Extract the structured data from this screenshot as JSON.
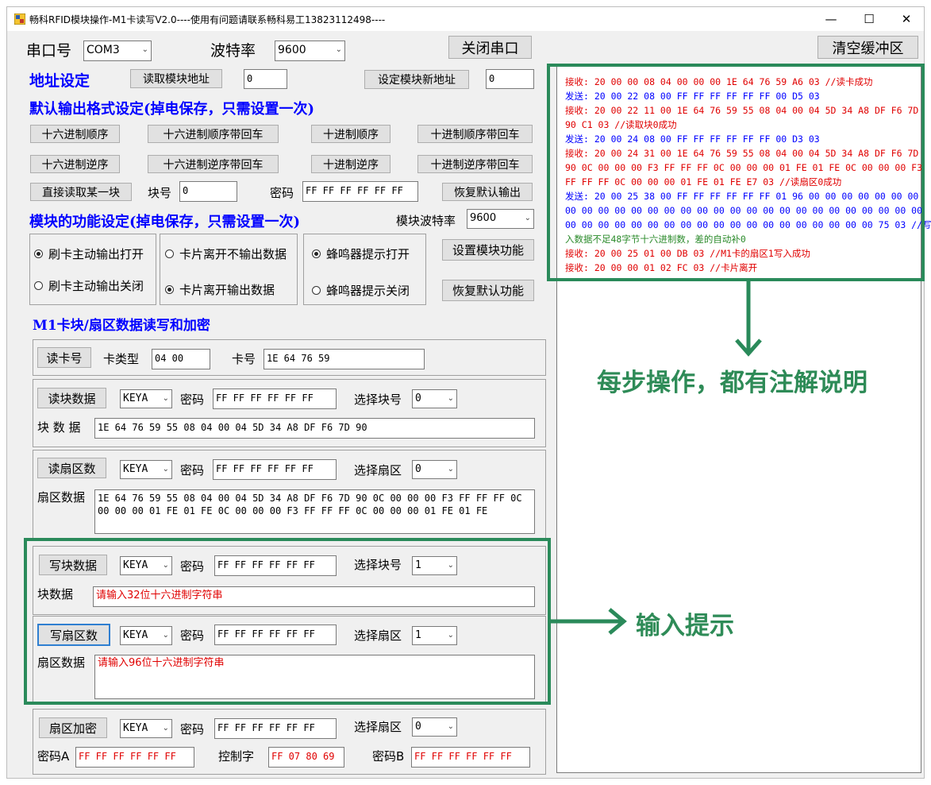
{
  "window": {
    "title": "畅科RFID模块操作-M1卡读写V2.0----使用有问题请联系畅科易工13823112498----",
    "minimize": "—",
    "maximize": "☐",
    "close": "✕"
  },
  "serial": {
    "port_label": "串口号",
    "port_value": "COM3",
    "baud_label": "波特率",
    "baud_value": "9600",
    "close_port_button": "关闭串口",
    "clear_buffer_button": "清空缓冲区"
  },
  "address": {
    "heading": "地址设定",
    "read_button": "读取模块地址",
    "read_value": "0",
    "set_button": "设定模块新地址",
    "set_value": "0"
  },
  "output_format": {
    "heading": "默认输出格式设定(掉电保存，只需设置一次)",
    "buttons": [
      "十六进制顺序",
      "十六进制顺序带回车",
      "十进制顺序",
      "十进制顺序带回车",
      "十六进制逆序",
      "十六进制逆序带回车",
      "十进制逆序",
      "十进制逆序带回车"
    ],
    "direct_read_button": "直接读取某一块",
    "block_label": "块号",
    "block_value": "0",
    "password_label": "密码",
    "password_value": "FF FF FF FF FF FF",
    "restore_output_button": "恢复默认输出"
  },
  "module_function": {
    "heading": "模块的功能设定(掉电保存，只需设置一次)",
    "baud_label": "模块波特率",
    "baud_value": "9600",
    "swipe_on": "刷卡主动输出打开",
    "swipe_off": "刷卡主动输出关闭",
    "leave_no_output": "卡片离开不输出数据",
    "leave_output": "卡片离开输出数据",
    "buzzer_on": "蜂鸣器提示打开",
    "buzzer_off": "蜂鸣器提示关闭",
    "set_function_button": "设置模块功能",
    "restore_function_button": "恢复默认功能"
  },
  "m1": {
    "heading": "M1卡块/扇区数据读写和加密",
    "read_card_button": "读卡号",
    "card_type_label": "卡类型",
    "card_type_value": "04 00",
    "card_no_label": "卡号",
    "card_no_value": "1E 64 76 59",
    "read_block_button": "读块数据",
    "key_value": "KEYA",
    "password_label": "密码",
    "password_value": "FF FF FF FF FF FF",
    "select_block_label": "选择块号",
    "read_block_no": "0",
    "block_data_label": "块 数 据",
    "block_data_value": "1E 64 76 59 55 08 04 00 04 5D 34 A8 DF F6 7D 90",
    "read_sector_button": "读扇区数",
    "select_sector_label": "选择扇区",
    "read_sector_no": "0",
    "sector_data_label": "扇区数据",
    "sector_data_value": "1E 64 76 59 55 08 04 00 04 5D 34 A8 DF F6 7D 90 0C 00 00 00 F3 FF FF FF 0C 00 00 00 01 FE 01 FE 0C 00 00 00 F3 FF FF FF 0C 00 00 00 01 FE 01 FE",
    "write_block_button": "写块数据",
    "write_block_no": "1",
    "write_block_data_label": "块数据",
    "write_block_placeholder": "请输入32位十六进制字符串",
    "write_sector_button": "写扇区数",
    "write_sector_no": "1",
    "write_sector_placeholder": "请输入96位十六进制字符串",
    "encrypt_button": "扇区加密",
    "encrypt_sector_no": "0",
    "pwd_a_label": "密码A",
    "pwd_a_value": "FF FF FF FF FF FF",
    "control_label": "控制字",
    "control_value": "FF 07 80 69",
    "pwd_b_label": "密码B",
    "pwd_b_value": "FF FF FF FF FF FF"
  },
  "log": [
    {
      "cls": "rx",
      "text": "接收: 20 00 00 08 04 00 00 00 1E 64 76 59 A6 03 //读卡成功"
    },
    {
      "cls": "tx",
      "text": "发送: 20 00 22 08 00 FF FF FF FF FF FF 00 D5 03"
    },
    {
      "cls": "rx",
      "text": "接收: 20 00 22 11 00 1E 64 76 59 55 08 04 00 04 5D 34 A8 DF F6 7D"
    },
    {
      "cls": "rx",
      "text": "90 C1 03 //读取块0成功"
    },
    {
      "cls": "tx",
      "text": "发送: 20 00 24 08 00 FF FF FF FF FF FF 00 D3 03"
    },
    {
      "cls": "rx",
      "text": "接收: 20 00 24 31 00 1E 64 76 59 55 08 04 00 04 5D 34 A8 DF F6 7D"
    },
    {
      "cls": "rx",
      "text": "90 0C 00 00 00 F3 FF FF FF 0C 00 00 00 01 FE 01 FE 0C 00 00 00 F3"
    },
    {
      "cls": "rx",
      "text": "FF FF FF 0C 00 00 00 01 FE 01 FE E7 03 //读扇区0成功"
    },
    {
      "cls": "tx",
      "text": "发送: 20 00 25 38 00 FF FF FF FF FF FF 01 96 00 00 00 00 00 00 00"
    },
    {
      "cls": "tx",
      "text": "00 00 00 00 00 00 00 00 00 00 00 00 00 00 00 00 00 00 00 00 00 00"
    },
    {
      "cls": "tx",
      "text": "00 00 00 00 00 00 00 00 00 00 00 00 00 00 00 00 00 00 00 75 03 //写"
    },
    {
      "cls": "note",
      "text": "入数据不足48字节十六进制数，差的自动补0"
    },
    {
      "cls": "rx",
      "text": "接收: 20 00 25 01 00 DB 03 //M1卡的扇区1写入成功"
    },
    {
      "cls": "rx",
      "text": "接收: 20 00 00 01 02 FC 03 //卡片离开"
    }
  ],
  "annotations": {
    "log_note": "每步操作，都有注解说明",
    "input_note": "输入提示"
  },
  "colors": {
    "heading_blue": "#0000ff",
    "annotation_green": "#2e8b57",
    "rx_red": "#e00000",
    "tx_blue": "#0000ff"
  }
}
